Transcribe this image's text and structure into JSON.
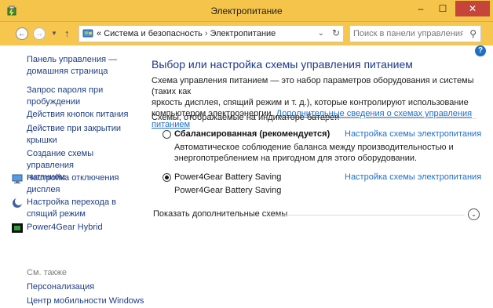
{
  "window": {
    "title": "Электропитание",
    "min_label": "‒",
    "max_label": "☐",
    "close_label": "✕"
  },
  "nav": {
    "back": "←",
    "forward": "→",
    "recent": "▼",
    "up": "↑",
    "prefix": "«",
    "crumbs": [
      "Система и безопасность",
      "Электропитание"
    ],
    "crumb_sep": "›",
    "drop": "⌄",
    "refresh": "↻",
    "search_placeholder": "Поиск в панели управления",
    "search_icon": "⚲"
  },
  "help": {
    "label": "?"
  },
  "sidebar": {
    "home_line1": "Панель управления —",
    "home_line2": "домашняя страница",
    "items": [
      {
        "line1": "Запрос пароля при",
        "line2": "пробуждении"
      },
      {
        "line1": "Действия кнопок питания",
        "line2": ""
      },
      {
        "line1": "Действие при закрытии",
        "line2": "крышки"
      },
      {
        "line1": "Создание схемы управления",
        "line2": "питанием"
      },
      {
        "line1": "Настройка отключения",
        "line2": "дисплея",
        "icon": "display-icon"
      },
      {
        "line1": "Настройка перехода в",
        "line2": "спящий режим",
        "icon": "sleep-moon-icon"
      },
      {
        "line1": "Power4Gear Hybrid",
        "line2": "",
        "icon": "power4gear-icon"
      }
    ],
    "see_also": "См. также",
    "see_also_items": [
      "Персонализация",
      "Центр мобильности Windows"
    ]
  },
  "main": {
    "title": "Выбор или настройка схемы управления питанием",
    "desc_line1": "Схема управления питанием — это набор параметров оборудования и системы (таких как",
    "desc_line2": "яркость дисплея, спящий режим и т. д.), которые контролируют использование",
    "desc_line3": "компьютером электроэнергии.",
    "desc_link": "Дополнительные сведения о схемах управления питанием",
    "group_label": "Схемы, отображаемые на индикаторе батареи",
    "plans": [
      {
        "name": "Сбалансированная (рекомендуется)",
        "link": "Настройка схемы электропитания",
        "desc_line1": "Автоматическое соблюдение баланса между производительностью и",
        "desc_line2": "энергопотреблением на пригодном для этого оборудовании.",
        "selected": false
      },
      {
        "name": "Power4Gear Battery Saving",
        "link": "Настройка схемы электропитания",
        "desc_line1": "Power4Gear Battery Saving",
        "desc_line2": "",
        "selected": true
      }
    ],
    "show_more": "Показать дополнительные схемы",
    "show_more_icon": "⌄"
  },
  "colors": {
    "titlebar": "#f5c44a",
    "close": "#c7443b",
    "link": "#1e6fcb",
    "heading": "#1e3a8a",
    "nav_link": "#1e3f84"
  }
}
